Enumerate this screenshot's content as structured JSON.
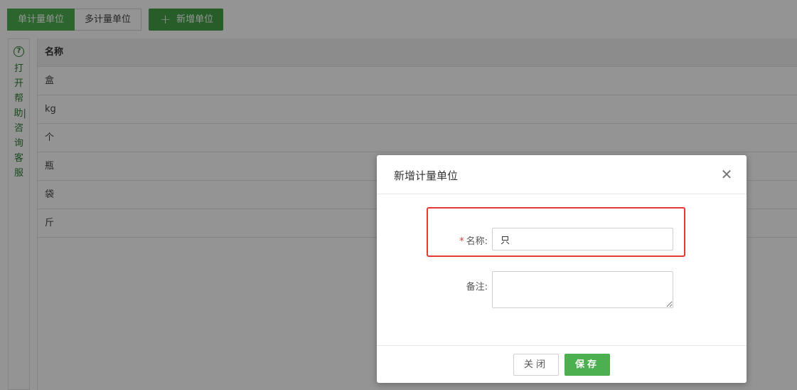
{
  "toolbar": {
    "tab_single": "单计量单位",
    "tab_multi": "多计量单位",
    "add_button_label": "新增单位",
    "add_button_icon": "plus-icon"
  },
  "help": {
    "icon": "question-circle-icon",
    "text": "打开帮助|咨询客服"
  },
  "table": {
    "header_name": "名称",
    "rows": [
      "盒",
      "kg",
      "个",
      "瓶",
      "袋",
      "斤"
    ]
  },
  "dialog": {
    "title": "新增计量单位",
    "close_icon": "close-icon",
    "name_label": "名称:",
    "required_mark": "*",
    "name_value": "只",
    "note_label": "备注:",
    "note_value": "",
    "close_button": "关闭",
    "save_button": "保存"
  },
  "colors": {
    "primary": "#4caf50",
    "highlight": "#e53935",
    "help_text": "#2e7d32"
  }
}
